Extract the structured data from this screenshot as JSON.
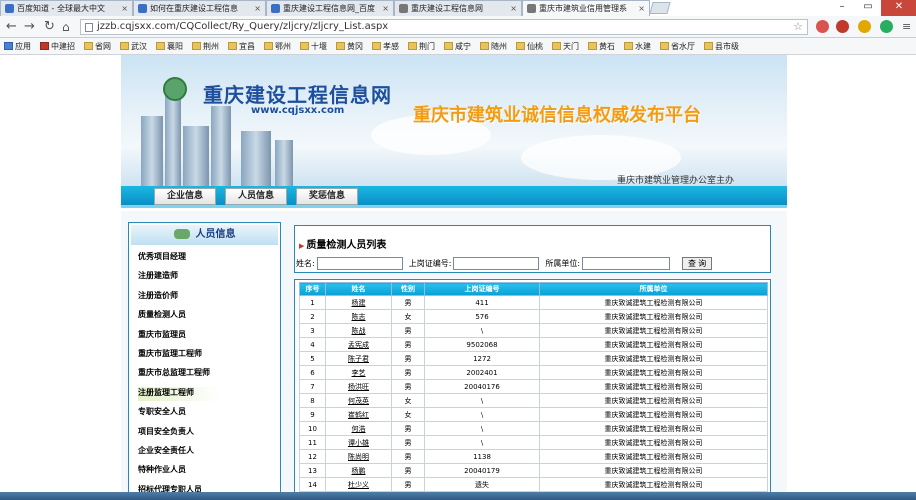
{
  "browser": {
    "tabs": [
      {
        "label": "百度知道 - 全球最大中文"
      },
      {
        "label": "如何在重庆建设工程信息"
      },
      {
        "label": "重庆建设工程信息网_百度"
      },
      {
        "label": "重庆建设工程信息网"
      },
      {
        "label": "重庆市建筑业信用管理系"
      }
    ],
    "url": "jzzb.cqjsxx.com/CQCollect/Ry_Query/zljcry/zljcry_List.aspx",
    "bookmarks": [
      "应用",
      "中建招",
      "省网",
      "武汉",
      "襄阳",
      "荆州",
      "宜昌",
      "鄂州",
      "十堰",
      "黄冈",
      "孝感",
      "荆门",
      "咸宁",
      "随州",
      "仙桃",
      "天门",
      "黄石",
      "水建",
      "省水厅",
      "县市级"
    ]
  },
  "site": {
    "logo_title": "重庆建设工程信息网",
    "logo_url": "www.cqjsxx.com",
    "slogan": "重庆市建筑业诚信信息权威发布平台",
    "host": "重庆市建筑业管理办公室主办"
  },
  "nav": [
    "企业信息",
    "人员信息",
    "奖惩信息"
  ],
  "sidebar": {
    "title": "人员信息",
    "items": [
      "优秀项目经理",
      "注册建造师",
      "注册造价师",
      "质量检测人员",
      "重庆市监理员",
      "重庆市监理工程师",
      "重庆市总监理工程师",
      "注册监理工程师",
      "专职安全人员",
      "项目安全负责人",
      "企业安全责任人",
      "特种作业人员",
      "招标代理专职人员"
    ],
    "selected_index": 7
  },
  "search": {
    "title": "质量检测人员列表",
    "name_label": "姓名:",
    "cert_label": "上岗证编号:",
    "unit_label": "所属单位:",
    "button": "查 询",
    "name_value": "",
    "cert_value": "",
    "unit_value": ""
  },
  "table": {
    "headers": [
      "序号",
      "姓名",
      "性别",
      "上岗证编号",
      "所属单位"
    ],
    "rows": [
      [
        "1",
        "杨建",
        "男",
        "411",
        "重庆致诚建筑工程检测有限公司"
      ],
      [
        "2",
        "陈志",
        "女",
        "576",
        "重庆致诚建筑工程检测有限公司"
      ],
      [
        "3",
        "陈战",
        "男",
        "\\",
        "重庆致诚建筑工程检测有限公司"
      ],
      [
        "4",
        "孟宪成",
        "男",
        "9502068",
        "重庆致诚建筑工程检测有限公司"
      ],
      [
        "5",
        "陈子君",
        "男",
        "1272",
        "重庆致诚建筑工程检测有限公司"
      ],
      [
        "6",
        "李艺",
        "男",
        "2002401",
        "重庆致诚建筑工程检测有限公司"
      ],
      [
        "7",
        "杨洪旺",
        "男",
        "20040176",
        "重庆致诚建筑工程检测有限公司"
      ],
      [
        "8",
        "何茂英",
        "女",
        "\\",
        "重庆致诚建筑工程检测有限公司"
      ],
      [
        "9",
        "崔鹤红",
        "女",
        "\\",
        "重庆致诚建筑工程检测有限公司"
      ],
      [
        "10",
        "何浩",
        "男",
        "\\",
        "重庆致诚建筑工程检测有限公司"
      ],
      [
        "11",
        "谭小雄",
        "男",
        "\\",
        "重庆致诚建筑工程检测有限公司"
      ],
      [
        "12",
        "陈尚明",
        "男",
        "1138",
        "重庆致诚建筑工程检测有限公司"
      ],
      [
        "13",
        "杨鹏",
        "男",
        "20040179",
        "重庆致诚建筑工程检测有限公司"
      ],
      [
        "14",
        "杜少义",
        "男",
        "遗失",
        "重庆致诚建筑工程检测有限公司"
      ]
    ]
  }
}
